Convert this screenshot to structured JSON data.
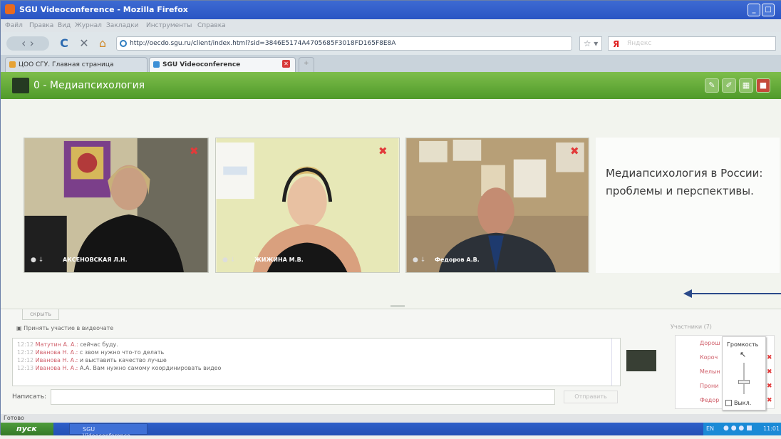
{
  "window": {
    "title": "SGU Videoconference - Mozilla Firefox"
  },
  "menu": [
    "Файл",
    "Правка",
    "Вид",
    "Журнал",
    "Закладки",
    "Инструменты",
    "Справка"
  ],
  "address": {
    "url": "http://oecdo.sgu.ru/client/index.html?sid=3846E5174A4705685F3018FD165F8E8A"
  },
  "search": {
    "engine": "Я",
    "placeholder": "Яндекс"
  },
  "tabs": [
    {
      "label": "ЦОО СГУ. Главная страница"
    },
    {
      "label": "SGU Videoconference"
    }
  ],
  "app": {
    "title": "0 - Медиапсихология",
    "accent": "#63ab37",
    "videos": [
      {
        "name": "АКСЕНОВСКАЯ Л.Н."
      },
      {
        "name": "ЖИЖИНА М.В."
      },
      {
        "name": "Федоров А.В."
      }
    ],
    "slide": {
      "line1": "Медиапсихология в России:",
      "line2": "проблемы и перспективы."
    }
  },
  "chat": {
    "hide_label": "скрыть",
    "join_label": "Принять участие в видеочате",
    "messages": [
      {
        "time": "12:12",
        "author": "Матутин А. А.:",
        "text": "сейчас буду."
      },
      {
        "time": "12:12",
        "author": "Иванова Н. А.:",
        "text": "с звом нужно что-то делать"
      },
      {
        "time": "12:12",
        "author": "Иванова Н. А.:",
        "text": "и выставить качество лучше"
      },
      {
        "time": "12:13",
        "author": "Иванова Н. А.:",
        "text": "А.А. Вам нужно самому координировать видео"
      }
    ],
    "write_label": "Написать:",
    "send_label": "Отправить"
  },
  "participants": {
    "header": "Участники (7)",
    "items": [
      "Дорош",
      "Короч",
      "Мелын",
      "Прони",
      "Федор"
    ],
    "volume_label": "Громкость",
    "mute_label": "Выкл."
  },
  "status": {
    "text": "Готово"
  },
  "taskbar": {
    "start": "пуск",
    "task": "SGU Videoconference...",
    "lang": "EN",
    "clock": "11:01"
  }
}
